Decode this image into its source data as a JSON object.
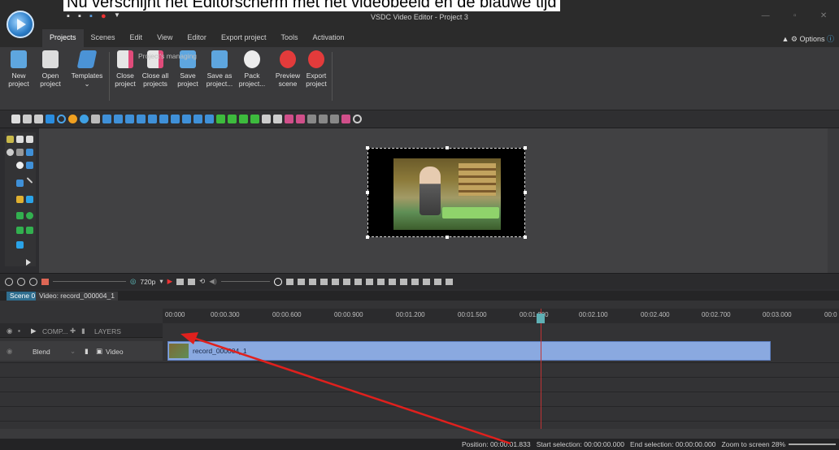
{
  "overlay_caption": "Nu verschijnt het Editorscherm met het videobeeld en de blauwe tijd",
  "window": {
    "title": "VSDC Video Editor - Project 3"
  },
  "menu": {
    "tabs": [
      "Projects",
      "Scenes",
      "Edit",
      "View",
      "Editor",
      "Export project",
      "Tools",
      "Activation"
    ],
    "options_label": "Options"
  },
  "ribbon": {
    "group_label": "Project's managing",
    "buttons": [
      {
        "line1": "New",
        "line2": "project",
        "icon": "new-project-icon"
      },
      {
        "line1": "Open",
        "line2": "project",
        "icon": "open-project-icon"
      },
      {
        "line1": "Templates",
        "line2": "⌄",
        "icon": "templates-icon"
      },
      {
        "line1": "Close",
        "line2": "project",
        "icon": "close-project-icon"
      },
      {
        "line1": "Close all",
        "line2": "projects",
        "icon": "close-all-icon"
      },
      {
        "line1": "Save",
        "line2": "project",
        "icon": "save-project-icon"
      },
      {
        "line1": "Save as",
        "line2": "project...",
        "icon": "save-as-icon"
      },
      {
        "line1": "Pack",
        "line2": "project...",
        "icon": "pack-project-icon"
      },
      {
        "line1": "Preview",
        "line2": "scene",
        "icon": "preview-scene-icon"
      },
      {
        "line1": "Export",
        "line2": "project",
        "icon": "export-project-icon"
      }
    ]
  },
  "playback": {
    "resolution": "720p"
  },
  "timeline": {
    "scene_tab": "Scene 0",
    "video_tab": "Video: record_000004_1",
    "ruler": [
      "00:000",
      "00:00.300",
      "00:00.600",
      "00:00.900",
      "00:01.200",
      "00:01.500",
      "00:01.800",
      "00:02.100",
      "00:02.400",
      "00:02.700",
      "00:03.000",
      "00:0"
    ],
    "layers_header": {
      "comp": "COMP...",
      "layers": "LAYERS"
    },
    "track": {
      "blend": "Blend",
      "type": "Video"
    },
    "clip_label": "record_000004_1"
  },
  "status": {
    "position_label": "Position:",
    "position": "00:00:01.833",
    "start_label": "Start selection:",
    "start": "00:00:00.000",
    "end_label": "End selection:",
    "end": "00:00:00.000",
    "zoom_label": "Zoom to screen",
    "zoom": "28%"
  },
  "colors": {
    "accent": "#2f6e8f",
    "clip": "#8aa9e0",
    "playhead": "#c03434",
    "arrow": "#e0201d"
  }
}
